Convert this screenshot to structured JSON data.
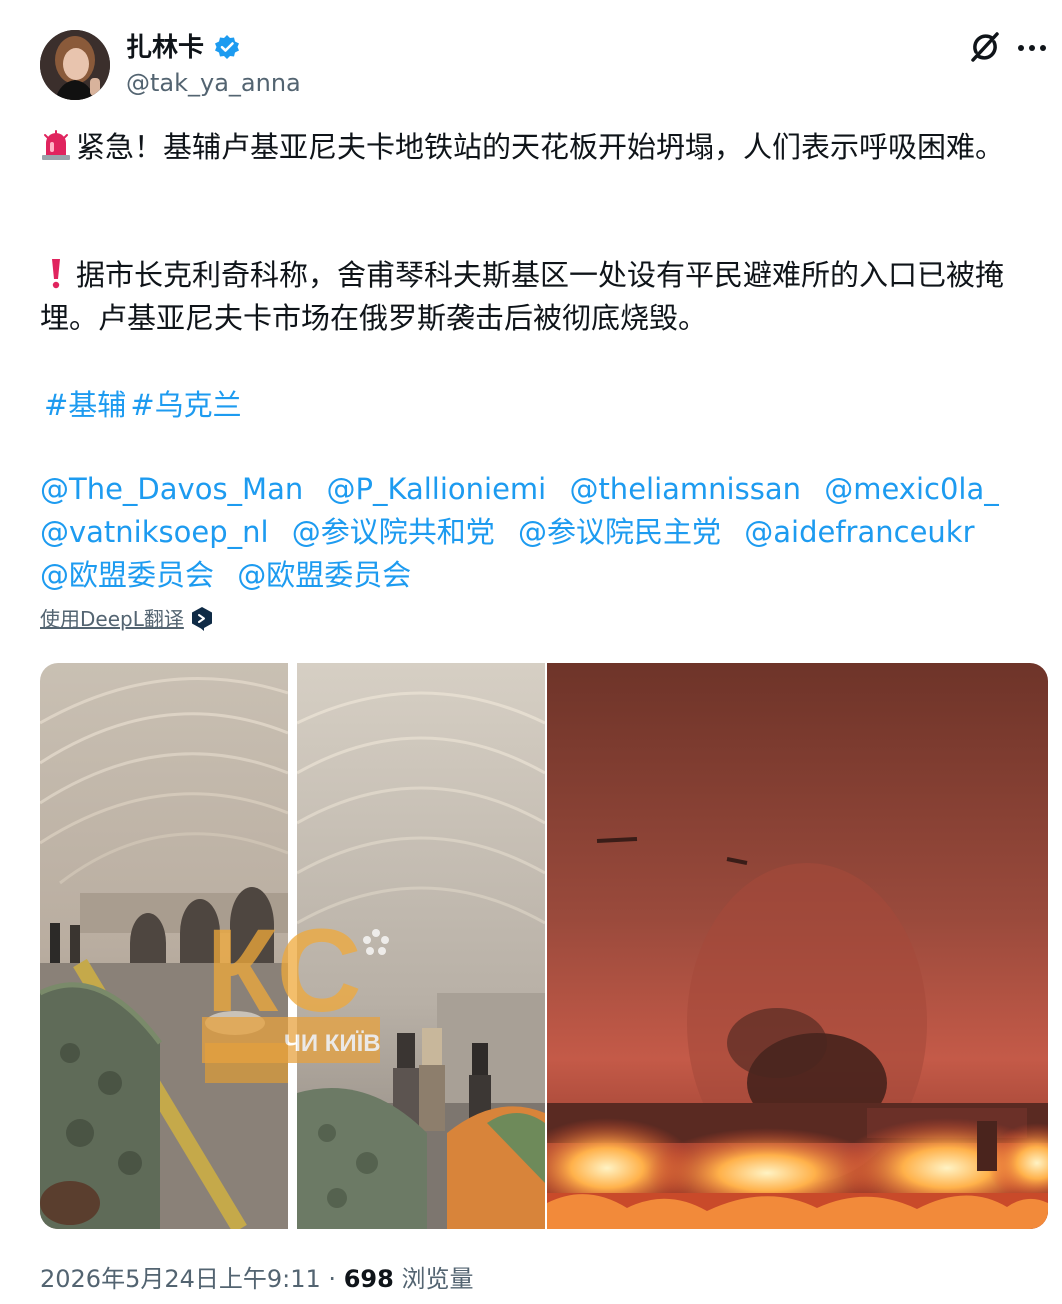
{
  "author": {
    "display_name": "扎林卡",
    "handle": "@tak_ya_anna"
  },
  "post": {
    "paragraph1": "紧急！基辅卢基亚尼夫卡地铁站的天花板开始坍塌，人们表示呼吸困难。",
    "paragraph2": "据市长克利奇科称，舍甫琴科夫斯基区一处设有平民避难所的入口已被掩埋。卢基亚尼夫卡市场在俄罗斯袭击后被彻底烧毁。",
    "hashtags": [
      "#基辅",
      "#乌克兰"
    ],
    "mentions": [
      "@The_Davos_Man",
      "@P_Kallioniemi",
      "@theliamnissan",
      "@mexic0la_",
      "@vatniksoep_nl",
      "@参议院共和党",
      "@参议院民主党",
      "@aidefranceukr",
      "@欧盟委员会",
      "@欧盟委员会"
    ],
    "translate_link": "使用DeepL翻译"
  },
  "media": {
    "watermark_text": "КС",
    "watermark_sub": "ЧИ КИЇВ"
  },
  "footer": {
    "timestamp": "2026年5月24日上午9:11",
    "separator": "·",
    "view_count": "698",
    "views_label": "浏览量"
  },
  "colors": {
    "link": "#1d9bf0",
    "secondary_text": "#536471",
    "verified": "#1d9bf0"
  },
  "icons": {
    "verified": "verified-badge-icon",
    "grok": "grok-icon",
    "more": "more-options-icon",
    "siren": "siren-emoji-icon",
    "exclamation": "red-exclamation-icon",
    "deepl": "deepl-icon"
  }
}
